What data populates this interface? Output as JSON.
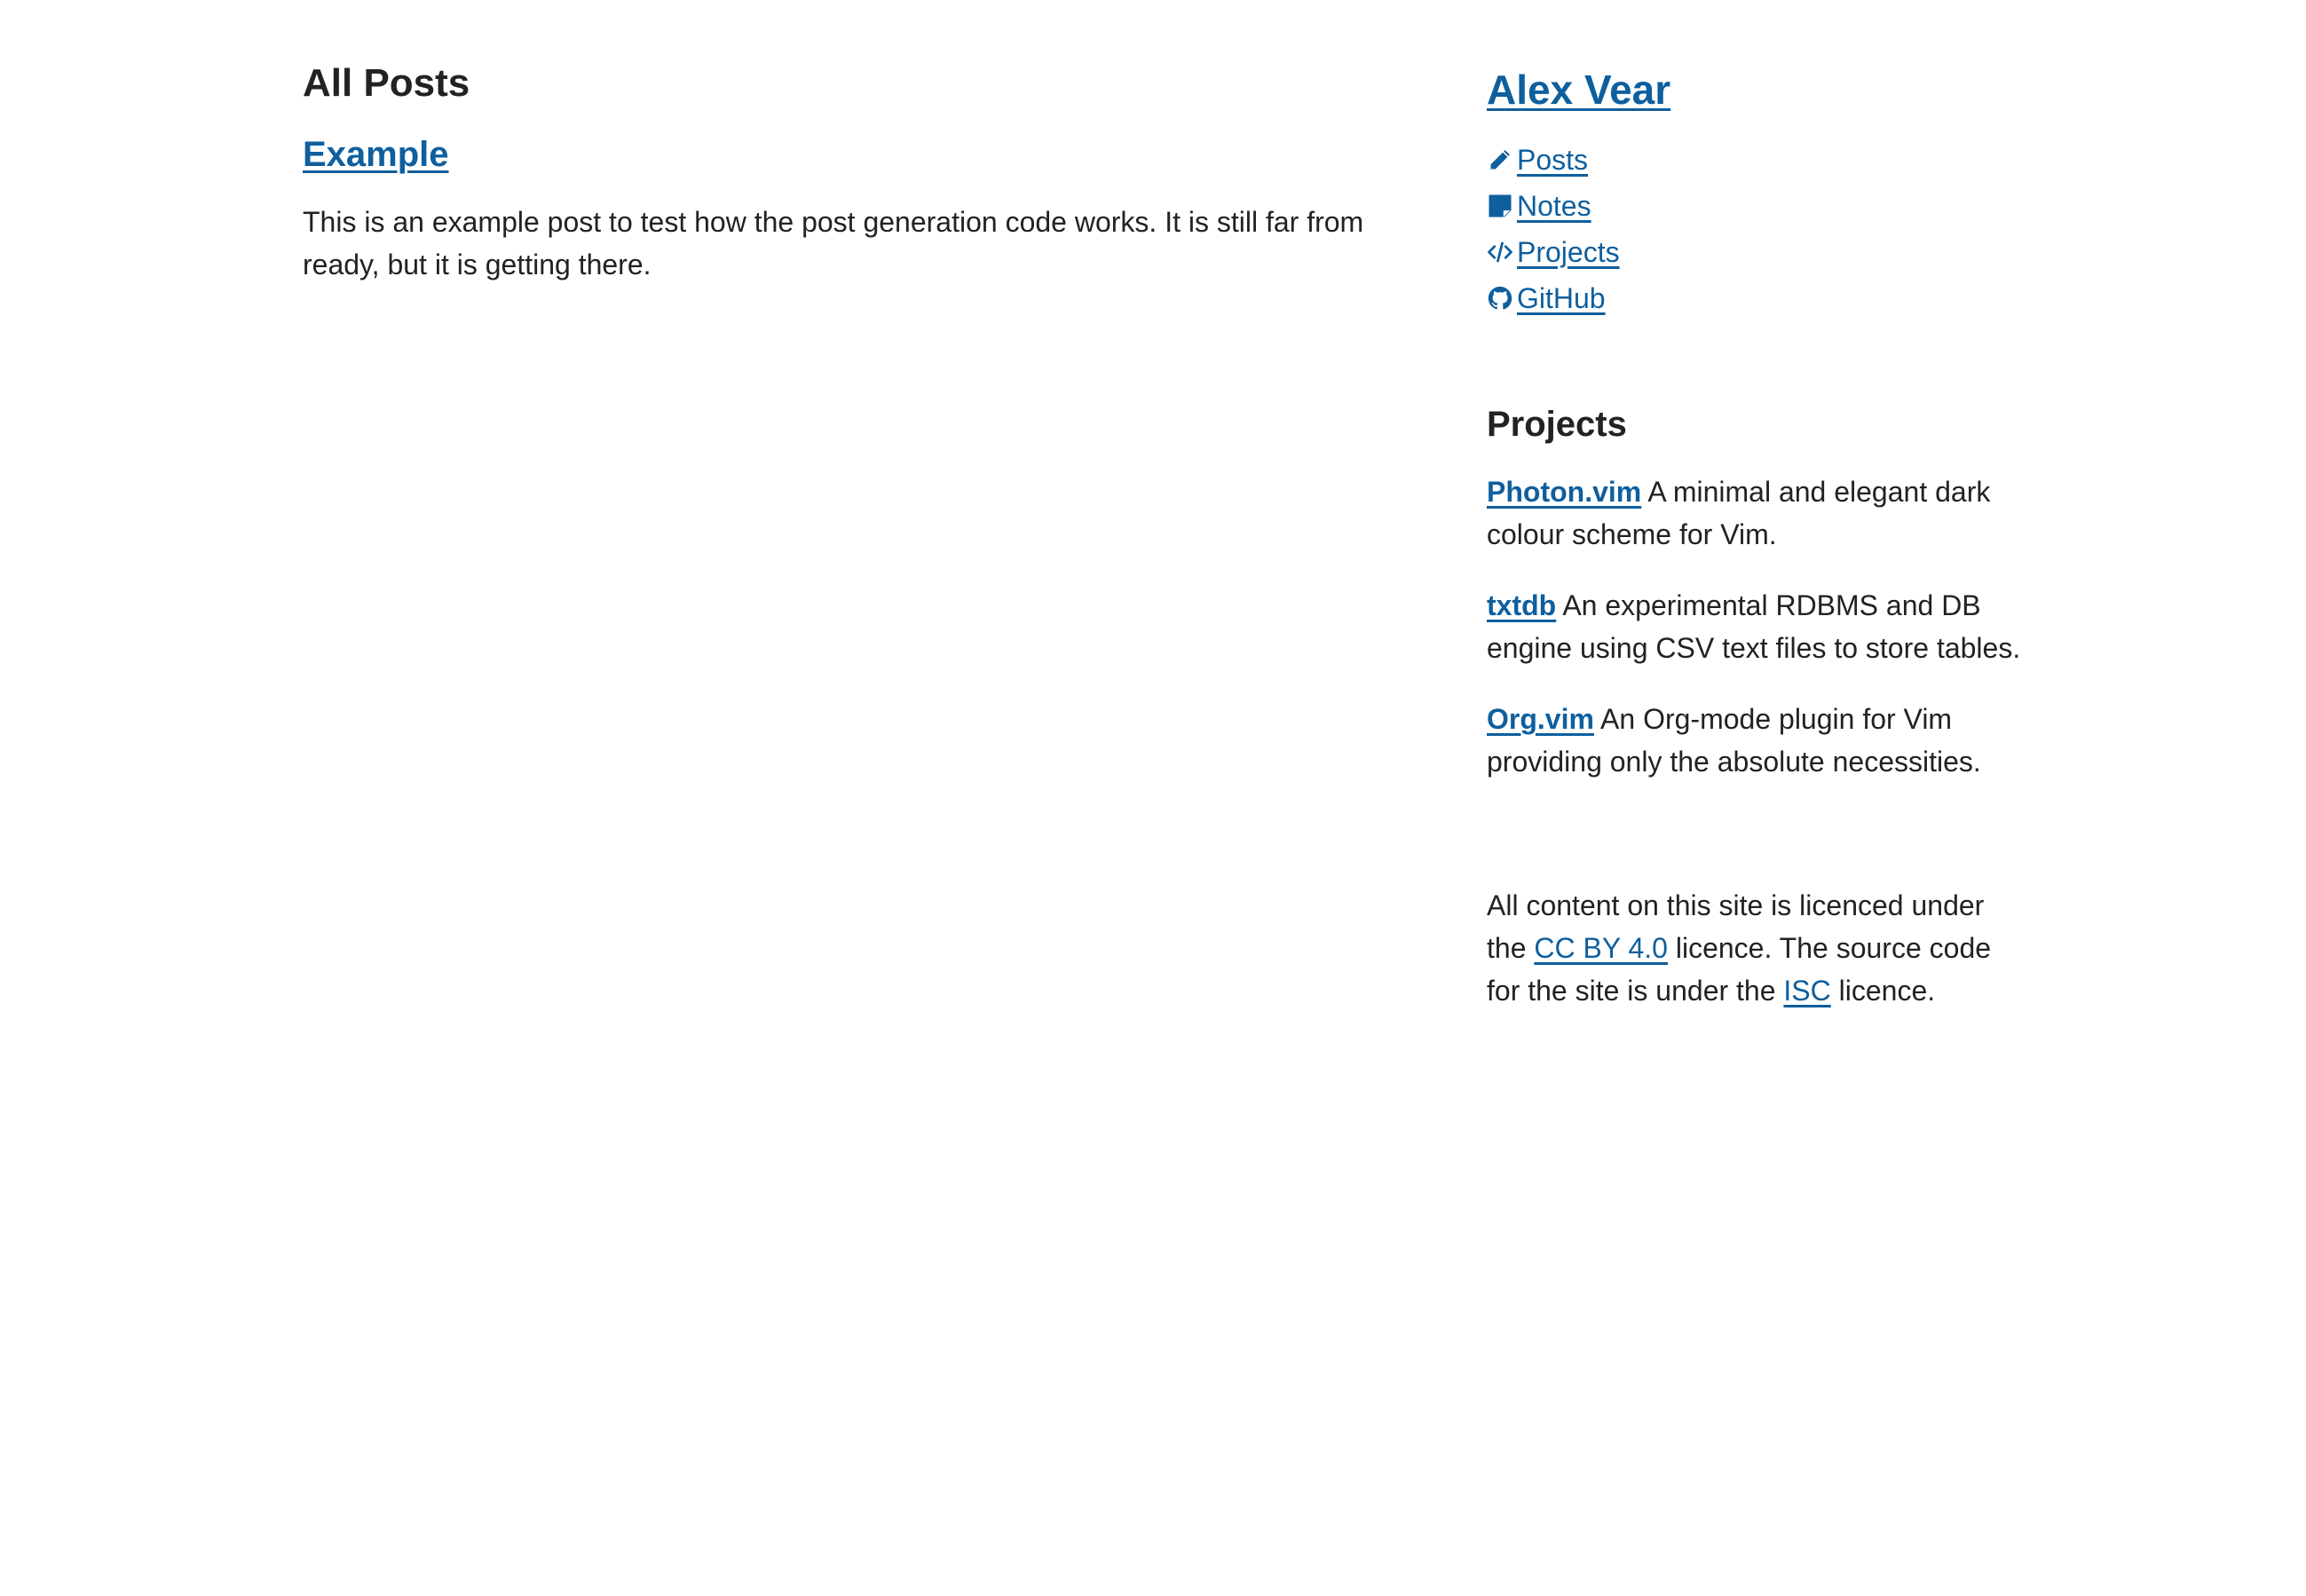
{
  "main": {
    "heading": "All Posts",
    "posts": [
      {
        "title": "Example",
        "summary": "This is an example post to test how the post generation code works. It is still far from ready, but it is getting there."
      }
    ]
  },
  "sidebar": {
    "site_title": "Alex Vear",
    "nav": [
      {
        "label": " Posts",
        "icon": "pencil-icon"
      },
      {
        "label": " Notes",
        "icon": "note-icon"
      },
      {
        "label": " Projects",
        "icon": "code-icon"
      },
      {
        "label": " GitHub",
        "icon": "github-icon"
      }
    ],
    "projects_heading": "Projects",
    "projects": [
      {
        "name": "Photon.vim",
        "description": " A minimal and elegant dark colour scheme for Vim."
      },
      {
        "name": "txtdb",
        "description": " An experimental RDBMS and DB engine using CSV text files to store tables."
      },
      {
        "name": "Org.vim",
        "description": " An Org-mode plugin for Vim providing only the absolute necessities."
      }
    ],
    "footer": {
      "part1": "All content on this site is licenced under the ",
      "link1": "CC BY 4.0",
      "part2": " licence. The source code for the site is under the ",
      "link2": "ISC",
      "part3": " licence."
    }
  },
  "colors": {
    "link": "#0e5f9e",
    "text": "#222222",
    "background": "#ffffff"
  }
}
